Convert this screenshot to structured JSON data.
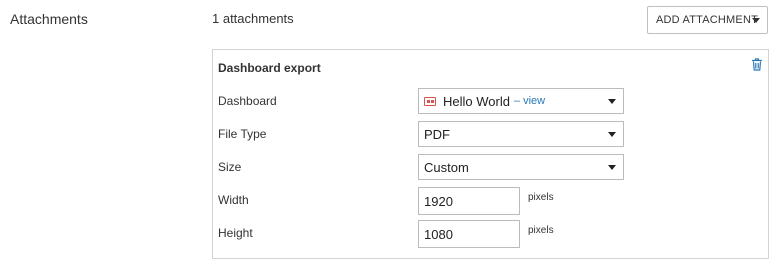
{
  "section": {
    "label": "Attachments",
    "count_text": "1 attachments",
    "add_button_label": "ADD ATTACHMENT"
  },
  "attachment": {
    "title": "Dashboard export",
    "fields": {
      "dashboard": {
        "label": "Dashboard",
        "value": "Hello World",
        "separator": "–",
        "link_label": "view",
        "icon": "dashboard-icon",
        "icon_color": "#d9534f"
      },
      "file_type": {
        "label": "File Type",
        "value": "PDF"
      },
      "size": {
        "label": "Size",
        "value": "Custom"
      },
      "width": {
        "label": "Width",
        "value": "1920",
        "unit": "pixels"
      },
      "height": {
        "label": "Height",
        "value": "1080",
        "unit": "pixels"
      }
    }
  },
  "colors": {
    "link": "#2a7ab8",
    "trash_icon": "#2a7ab8",
    "border": "#d3d3d3"
  }
}
